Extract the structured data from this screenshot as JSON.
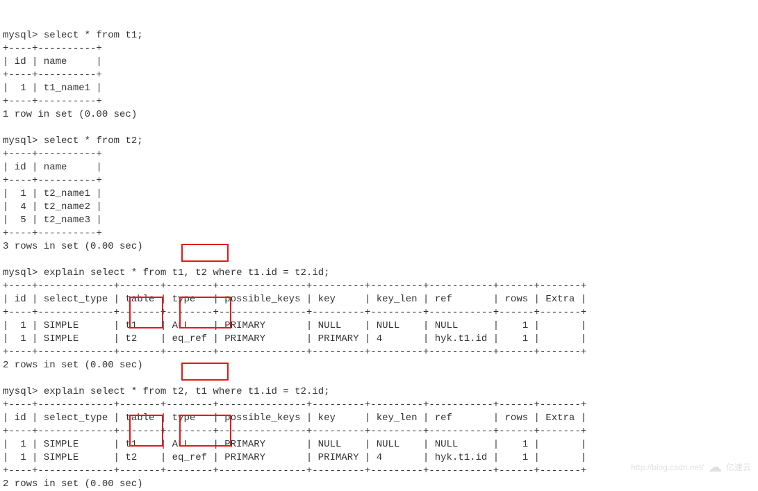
{
  "prompt": "mysql>",
  "q1": {
    "cmd": "select * from t1;",
    "border": "+----+----------+",
    "header": "| id | name     |",
    "rows": [
      "|  1 | t1_name1 |"
    ],
    "footer": "1 row in set (0.00 sec)"
  },
  "q2": {
    "cmd": "select * from t2;",
    "border": "+----+----------+",
    "header": "| id | name     |",
    "rows": [
      "|  1 | t2_name1 |",
      "|  4 | t2_name2 |",
      "|  5 | t2_name3 |"
    ],
    "footer": "3 rows in set (0.00 sec)"
  },
  "e1": {
    "cmd_a": "explain select * from ",
    "cmd_hl": "t1, t2",
    "cmd_b": " where t1.id = t2.id;",
    "border": "+----+-------------+-------+--------+---------------+---------+---------+-----------+------+-------+",
    "header": "| id | select_type | table | type   | possible_keys | key     | key_len | ref       | rows | Extra |",
    "row1": "|  1 | SIMPLE      | t1    | ALL    | PRIMARY       | NULL    | NULL    | NULL      |    1 |       |",
    "row2": "|  1 | SIMPLE      | t2    | eq_ref | PRIMARY       | PRIMARY | 4       | hyk.t1.id |    1 |       |",
    "footer": "2 rows in set (0.00 sec)"
  },
  "e2": {
    "cmd_a": "explain select * from ",
    "cmd_hl": "t2, t1",
    "cmd_b": " where t1.id = t2.id;",
    "border": "+----+-------------+-------+--------+---------------+---------+---------+-----------+------+-------+",
    "header": "| id | select_type | table | type   | possible_keys | key     | key_len | ref       | rows | Extra |",
    "row1": "|  1 | SIMPLE      | t1    | ALL    | PRIMARY       | NULL    | NULL    | NULL      |    1 |       |",
    "row2": "|  1 | SIMPLE      | t2    | eq_ref | PRIMARY       | PRIMARY | 4       | hyk.t1.id |    1 |       |",
    "footer": "2 rows in set (0.00 sec)"
  },
  "watermark": {
    "url": "http://blog.csdn.net/",
    "brand": "亿速云"
  }
}
